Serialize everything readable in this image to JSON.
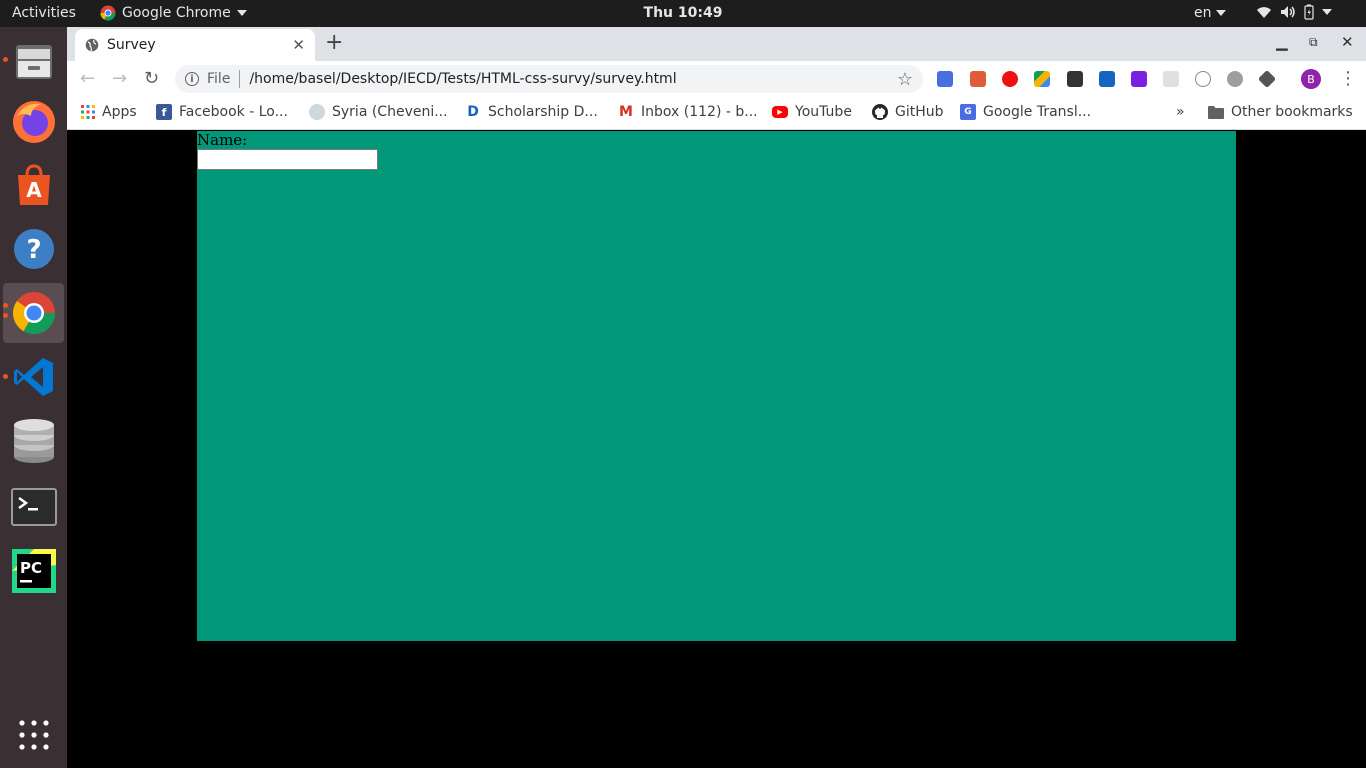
{
  "topbar": {
    "activities": "Activities",
    "app_name": "Google Chrome",
    "clock": "Thu 10:49",
    "language": "en"
  },
  "dock": {
    "items": [
      "files-icon",
      "firefox-icon",
      "software-center-icon",
      "help-icon",
      "chrome-icon",
      "vscode-icon",
      "database-icon",
      "terminal-icon",
      "pycharm-icon"
    ],
    "show_apps": "show-applications-icon"
  },
  "browser": {
    "tab_title": "Survey",
    "omnibox_scheme": "File",
    "url": "/home/basel/Desktop/IECD/Tests/HTML-css-survy/survey.html",
    "profile_initial": "B",
    "bookmarks": [
      {
        "label": "Apps"
      },
      {
        "label": "Facebook - Lo..."
      },
      {
        "label": "Syria (Cheveni..."
      },
      {
        "label": "Scholarship D..."
      },
      {
        "label": "Inbox (112) - b..."
      },
      {
        "label": "YouTube"
      },
      {
        "label": "GitHub"
      },
      {
        "label": "Google Transl..."
      }
    ],
    "overflow": "»",
    "other_bookmarks": "Other bookmarks"
  },
  "page": {
    "name_label": "Name:",
    "name_value": "",
    "background_color": "#009879"
  }
}
